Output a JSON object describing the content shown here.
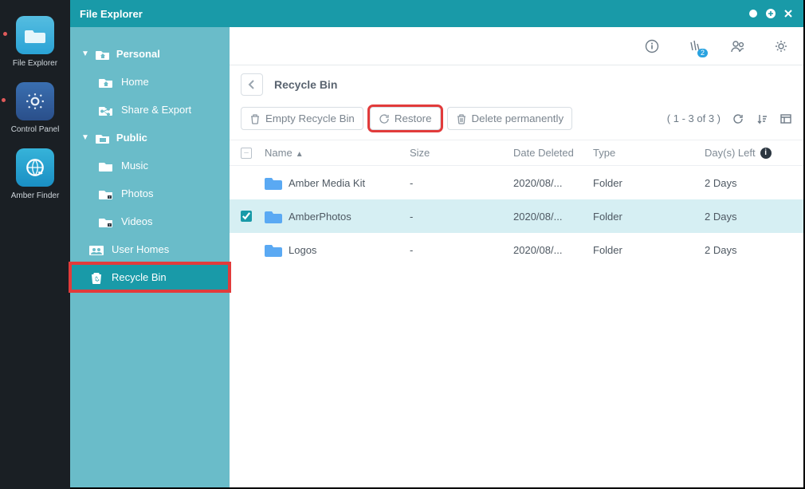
{
  "dock": [
    {
      "label": "File Explorer"
    },
    {
      "label": "Control Panel"
    },
    {
      "label": "Amber Finder"
    }
  ],
  "window_title": "File Explorer",
  "sidebar": {
    "personal": {
      "label": "Personal",
      "items": [
        {
          "label": "Home"
        },
        {
          "label": "Share & Export"
        }
      ]
    },
    "public": {
      "label": "Public",
      "items": [
        {
          "label": "Music"
        },
        {
          "label": "Photos"
        },
        {
          "label": "Videos"
        }
      ]
    },
    "user_homes": {
      "label": "User Homes"
    },
    "recycle": {
      "label": "Recycle Bin"
    }
  },
  "topbar_badge": "2",
  "breadcrumb": "Recycle Bin",
  "toolbar": {
    "empty": "Empty Recycle Bin",
    "restore": "Restore",
    "delete": "Delete permanently",
    "pager": "( 1 - 3 of 3 )"
  },
  "columns": {
    "name": "Name",
    "size": "Size",
    "date": "Date Deleted",
    "type": "Type",
    "days": "Day(s) Left"
  },
  "rows": [
    {
      "name": "Amber Media Kit",
      "size": "-",
      "date": "2020/08/...",
      "type": "Folder",
      "days": "2 Days",
      "selected": false
    },
    {
      "name": "AmberPhotos",
      "size": "-",
      "date": "2020/08/...",
      "type": "Folder",
      "days": "2 Days",
      "selected": true
    },
    {
      "name": "Logos",
      "size": "-",
      "date": "2020/08/...",
      "type": "Folder",
      "days": "2 Days",
      "selected": false
    }
  ]
}
